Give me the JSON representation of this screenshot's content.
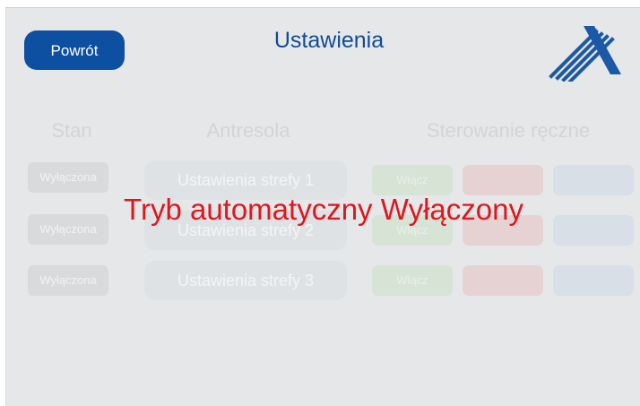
{
  "header": {
    "back_label": "Powrót",
    "title": "Ustawienia",
    "logo_icon": "company-logo-icon"
  },
  "columns": {
    "state": "Stan",
    "zone": "Antresola",
    "manual": "Sterowanie ręczne"
  },
  "rows": [
    {
      "state": "Wyłączona",
      "zone_button": "Ustawienia strefy 1",
      "on": "Włącz",
      "off": "",
      "stop": ""
    },
    {
      "state": "Wyłączona",
      "zone_button": "Ustawienia strefy 2",
      "on": "Włącz",
      "off": "",
      "stop": ""
    },
    {
      "state": "Wyłączona",
      "zone_button": "Ustawienia strefy 3",
      "on": "Włącz",
      "off": "",
      "stop": ""
    }
  ],
  "overlay_message": "Tryb automatyczny Wyłączony",
  "colors": {
    "primary": "#0d4fa0",
    "title": "#114b96",
    "alert": "#e0161c",
    "background": "#e6e7e8"
  }
}
